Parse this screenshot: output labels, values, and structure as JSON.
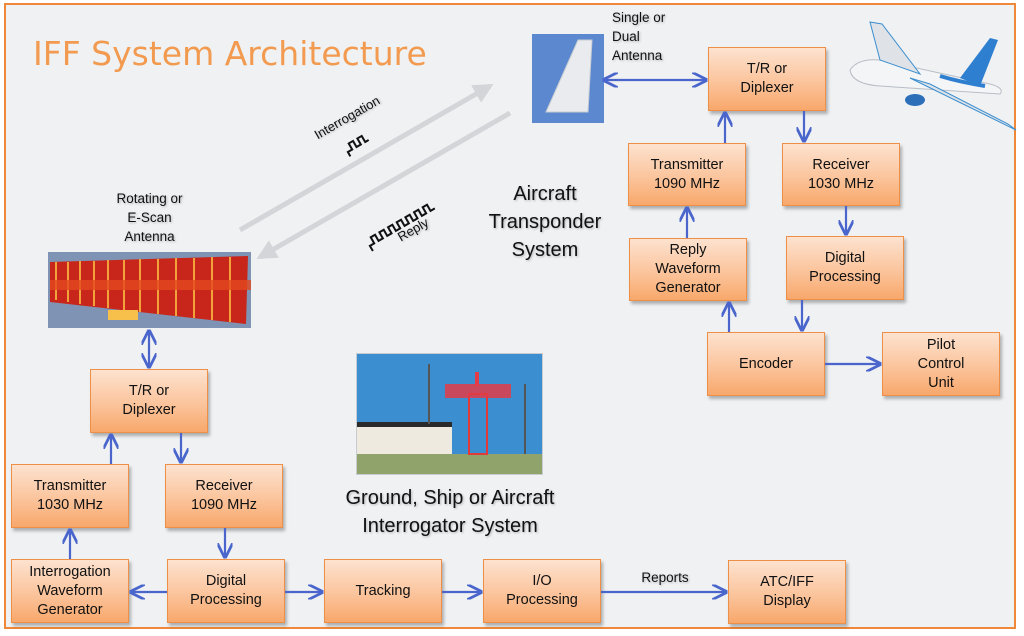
{
  "title": "IFF System Architecture",
  "colors": {
    "frame": "#f0883a",
    "title": "#f29b50",
    "box_border": "#ee8f48",
    "arrow": "#4a66cc",
    "background": "#eff1f3"
  },
  "aircraft": {
    "antenna_label": "Single or\nDual\nAntenna",
    "system_label": "Aircraft\nTransponder\nSystem",
    "boxes": {
      "tr_diplexer": "T/R or\nDiplexer",
      "transmitter": "Transmitter\n1090 MHz",
      "receiver": "Receiver\n1030 MHz",
      "reply_waveform": "Reply\nWaveform\nGenerator",
      "digital_processing": "Digital\nProcessing",
      "encoder": "Encoder",
      "pilot_control": "Pilot\nControl\nUnit"
    }
  },
  "ground": {
    "antenna_label": "Rotating or\nE-Scan\nAntenna",
    "system_label": "Ground, Ship or Aircraft\nInterrogator System",
    "boxes": {
      "tr_diplexer": "T/R or\nDiplexer",
      "transmitter": "Transmitter\n1030 MHz",
      "receiver": "Receiver\n1090 MHz",
      "interrogation_waveform": "Interrogation\nWaveform\nGenerator",
      "digital_processing": "Digital\nProcessing",
      "tracking": "Tracking",
      "io_processing": "I/O\nProcessing",
      "atc_display": "ATC/IFF\nDisplay"
    }
  },
  "links": {
    "interrogation": "Interrogation",
    "reply": "Reply",
    "reports": "Reports"
  }
}
